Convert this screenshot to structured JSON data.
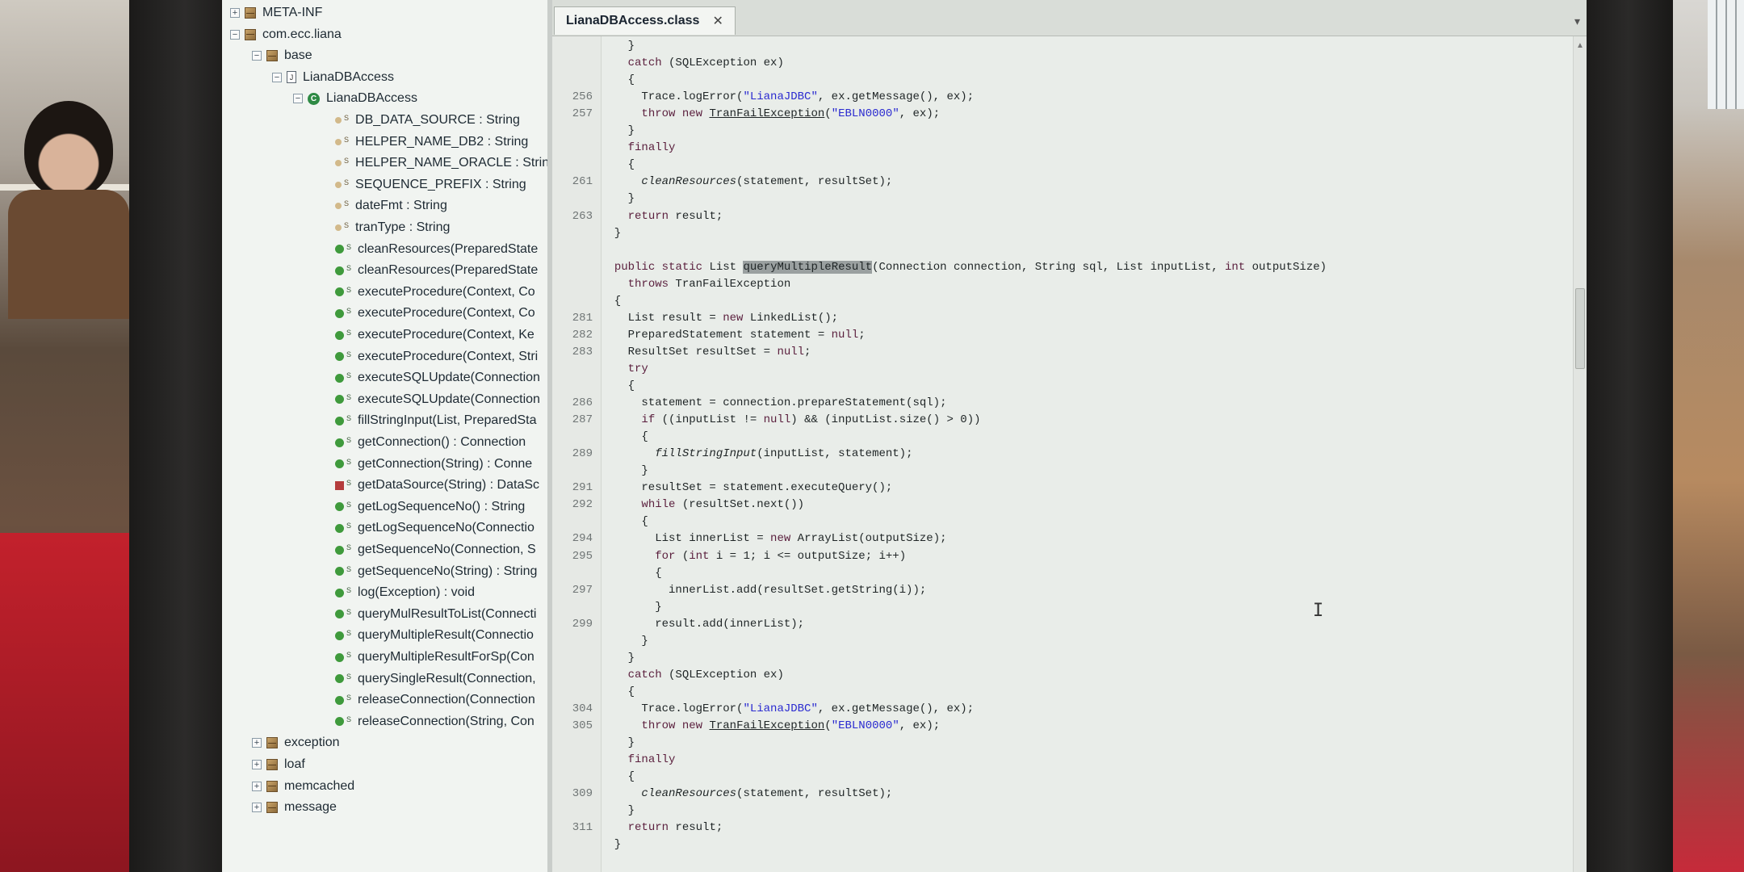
{
  "tree": {
    "nodes": [
      {
        "label": "META-INF",
        "toggle": "+",
        "icon": "package",
        "level": 0
      },
      {
        "label": "com.ecc.liana",
        "toggle": "−",
        "icon": "package",
        "level": 0
      },
      {
        "label": "base",
        "toggle": "−",
        "icon": "package",
        "level": 1
      },
      {
        "label": "LianaDBAccess",
        "toggle": "−",
        "icon": "classfile",
        "level": 2
      },
      {
        "label": "LianaDBAccess",
        "toggle": "−",
        "icon": "class",
        "level": 3
      },
      {
        "label": "DB_DATA_SOURCE : String",
        "icon": "field",
        "level": 4
      },
      {
        "label": "HELPER_NAME_DB2 : String",
        "icon": "field",
        "level": 4
      },
      {
        "label": "HELPER_NAME_ORACLE : Strin",
        "icon": "field",
        "level": 4
      },
      {
        "label": "SEQUENCE_PREFIX : String",
        "icon": "field",
        "level": 4
      },
      {
        "label": "dateFmt : String",
        "icon": "field",
        "level": 4
      },
      {
        "label": "tranType : String",
        "icon": "field",
        "level": 4
      },
      {
        "label": "cleanResources(PreparedState",
        "icon": "method",
        "level": 4
      },
      {
        "label": "cleanResources(PreparedState",
        "icon": "method",
        "level": 4
      },
      {
        "label": "executeProcedure(Context, Co",
        "icon": "method",
        "level": 4
      },
      {
        "label": "executeProcedure(Context, Co",
        "icon": "method",
        "level": 4
      },
      {
        "label": "executeProcedure(Context, Ke",
        "icon": "method",
        "level": 4
      },
      {
        "label": "executeProcedure(Context, Stri",
        "icon": "method",
        "level": 4
      },
      {
        "label": "executeSQLUpdate(Connection",
        "icon": "method",
        "level": 4
      },
      {
        "label": "executeSQLUpdate(Connection",
        "icon": "method",
        "level": 4
      },
      {
        "label": "fillStringInput(List, PreparedSta",
        "icon": "method",
        "level": 4
      },
      {
        "label": "getConnection() : Connection",
        "icon": "method",
        "level": 4
      },
      {
        "label": "getConnection(String) : Conne",
        "icon": "method",
        "level": 4
      },
      {
        "label": "getDataSource(String) : DataSc",
        "icon": "method-private",
        "level": 4
      },
      {
        "label": "getLogSequenceNo() : String",
        "icon": "method",
        "level": 4
      },
      {
        "label": "getLogSequenceNo(Connectio",
        "icon": "method",
        "level": 4
      },
      {
        "label": "getSequenceNo(Connection, S",
        "icon": "method",
        "level": 4
      },
      {
        "label": "getSequenceNo(String) : String",
        "icon": "method",
        "level": 4
      },
      {
        "label": "log(Exception) : void",
        "icon": "method",
        "level": 4
      },
      {
        "label": "queryMulResultToList(Connecti",
        "icon": "method",
        "level": 4
      },
      {
        "label": "queryMultipleResult(Connectio",
        "icon": "method",
        "level": 4
      },
      {
        "label": "queryMultipleResultForSp(Con",
        "icon": "method",
        "level": 4
      },
      {
        "label": "querySingleResult(Connection,",
        "icon": "method",
        "level": 4
      },
      {
        "label": "releaseConnection(Connection",
        "icon": "method",
        "level": 4
      },
      {
        "label": "releaseConnection(String, Con",
        "icon": "method",
        "level": 4
      },
      {
        "label": "exception",
        "toggle": "+",
        "icon": "package",
        "level": 1
      },
      {
        "label": "loaf",
        "toggle": "+",
        "icon": "package",
        "level": 1
      },
      {
        "label": "memcached",
        "toggle": "+",
        "icon": "package",
        "level": 1
      },
      {
        "label": "message",
        "toggle": "+",
        "icon": "package",
        "level": 1
      }
    ]
  },
  "editor": {
    "tab_label": "LianaDBAccess.class",
    "tab_close": "✕",
    "tab_menu": "▾"
  },
  "code_lines": [
    {
      "ln": "",
      "text": "    }"
    },
    {
      "ln": "",
      "text": "    catch (SQLException ex)"
    },
    {
      "ln": "",
      "text": "    {"
    },
    {
      "ln": "256",
      "text": "      Trace.logError(\"LianaJDBC\", ex.getMessage(), ex);"
    },
    {
      "ln": "257",
      "text": "      throw new TranFailException(\"EBLN0000\", ex);"
    },
    {
      "ln": "",
      "text": "    }"
    },
    {
      "ln": "",
      "text": "    finally"
    },
    {
      "ln": "",
      "text": "    {"
    },
    {
      "ln": "261",
      "text": "      cleanResources(statement, resultSet);"
    },
    {
      "ln": "",
      "text": "    }"
    },
    {
      "ln": "263",
      "text": "    return result;"
    },
    {
      "ln": "",
      "text": "  }"
    },
    {
      "ln": "",
      "text": ""
    },
    {
      "ln": "",
      "text": "  public static List queryMultipleResult(Connection connection, String sql, List inputList, int outputSize)"
    },
    {
      "ln": "",
      "text": "    throws TranFailException"
    },
    {
      "ln": "",
      "text": "  {"
    },
    {
      "ln": "281",
      "text": "    List result = new LinkedList();"
    },
    {
      "ln": "282",
      "text": "    PreparedStatement statement = null;"
    },
    {
      "ln": "283",
      "text": "    ResultSet resultSet = null;"
    },
    {
      "ln": "",
      "text": "    try"
    },
    {
      "ln": "",
      "text": "    {"
    },
    {
      "ln": "286",
      "text": "      statement = connection.prepareStatement(sql);"
    },
    {
      "ln": "287",
      "text": "      if ((inputList != null) && (inputList.size() > 0))"
    },
    {
      "ln": "",
      "text": "      {"
    },
    {
      "ln": "289",
      "text": "        fillStringInput(inputList, statement);"
    },
    {
      "ln": "",
      "text": "      }"
    },
    {
      "ln": "291",
      "text": "      resultSet = statement.executeQuery();"
    },
    {
      "ln": "292",
      "text": "      while (resultSet.next())"
    },
    {
      "ln": "",
      "text": "      {"
    },
    {
      "ln": "294",
      "text": "        List innerList = new ArrayList(outputSize);"
    },
    {
      "ln": "295",
      "text": "        for (int i = 1; i <= outputSize; i++)"
    },
    {
      "ln": "",
      "text": "        {"
    },
    {
      "ln": "297",
      "text": "          innerList.add(resultSet.getString(i));"
    },
    {
      "ln": "",
      "text": "        }"
    },
    {
      "ln": "299",
      "text": "        result.add(innerList);"
    },
    {
      "ln": "",
      "text": "      }"
    },
    {
      "ln": "",
      "text": "    }"
    },
    {
      "ln": "",
      "text": "    catch (SQLException ex)"
    },
    {
      "ln": "",
      "text": "    {"
    },
    {
      "ln": "304",
      "text": "      Trace.logError(\"LianaJDBC\", ex.getMessage(), ex);"
    },
    {
      "ln": "305",
      "text": "      throw new TranFailException(\"EBLN0000\", ex);"
    },
    {
      "ln": "",
      "text": "    }"
    },
    {
      "ln": "",
      "text": "    finally"
    },
    {
      "ln": "",
      "text": "    {"
    },
    {
      "ln": "309",
      "text": "      cleanResources(statement, resultSet);"
    },
    {
      "ln": "",
      "text": "    }"
    },
    {
      "ln": "311",
      "text": "    return result;"
    },
    {
      "ln": "",
      "text": "  }"
    }
  ],
  "colors": {
    "keyword": "#5a1f3d",
    "string": "#2a2ad0",
    "highlight": "#9aa0a0"
  }
}
